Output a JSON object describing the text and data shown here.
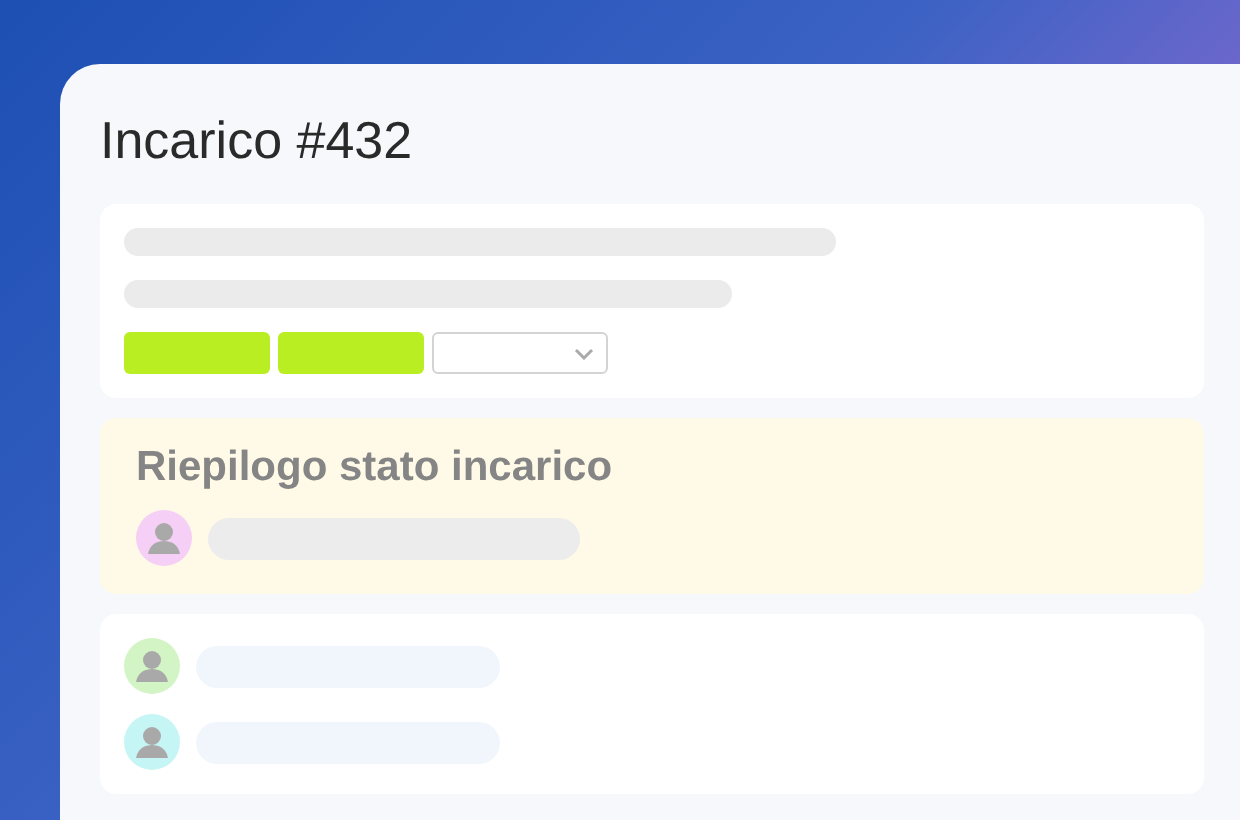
{
  "title": "Incarico #432",
  "summary": {
    "heading": "Riepilogo stato incarico",
    "owner": {
      "color": "#f5cff5"
    }
  },
  "assignees": [
    {
      "color": "#d3f5c6"
    },
    {
      "color": "#c6f5f5"
    }
  ]
}
